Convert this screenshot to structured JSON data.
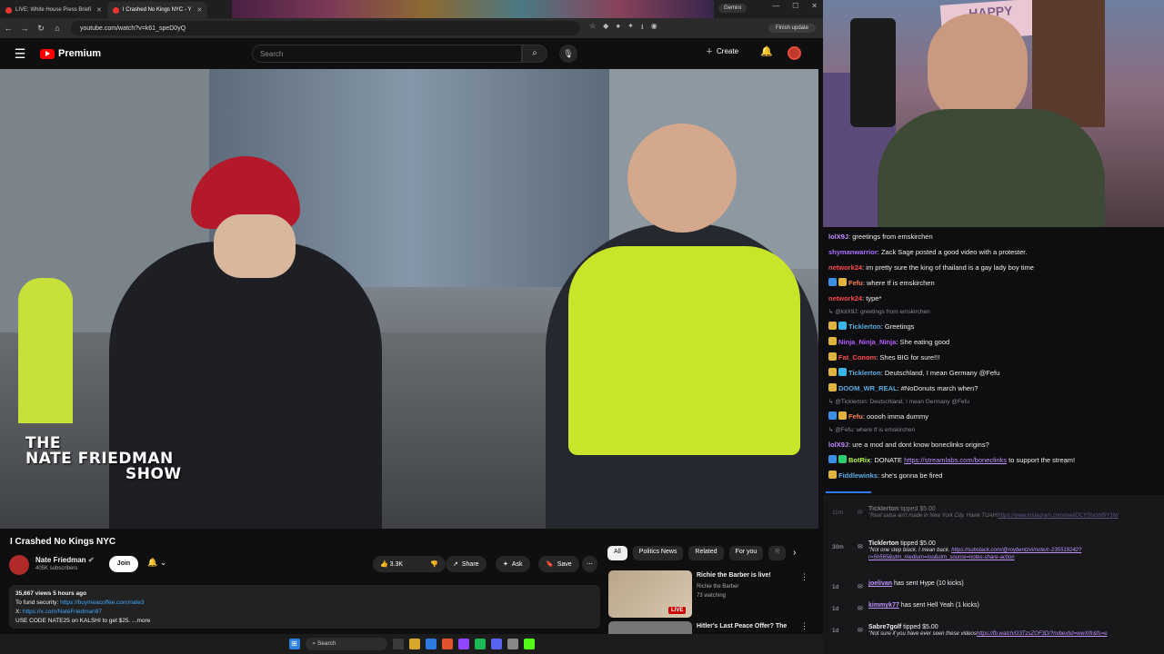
{
  "browser": {
    "tabs": [
      {
        "label": "LIVE: White House Press Briefi"
      },
      {
        "label": "I Crashed No Kings NYC - Y"
      }
    ],
    "gemini_label": "Gemini",
    "url": "youtube.com/watch?v=k61_speD0yQ",
    "finish_update": "Finish update"
  },
  "youtube": {
    "logo_text": "Premium",
    "search_placeholder": "Search",
    "create_label": "Create",
    "video_overlay": {
      "line1": "THE",
      "line2": "NATE FRIEDMAN",
      "line3": "SHOW"
    },
    "title": "I Crashed No Kings NYC",
    "channel": {
      "name": "Nate Friedman",
      "subscribers": "405K subscribers",
      "join": "Join"
    },
    "actions": {
      "likes": "3.3K",
      "share": "Share",
      "ask": "Ask",
      "save": "Save"
    },
    "description": {
      "meta": "35,667 views  5 hours ago",
      "line2_prefix": "To fund security: ",
      "line2_link": "https://buymeacoffee.com/nate3",
      "line3_prefix": "X: ",
      "line3_link": "https://x.com/NateFriedman97",
      "line4": "USE CODE NATE25 on KALSHI to get $25. ...more"
    },
    "chips": [
      "All",
      "Politics News",
      "Related",
      "For you",
      "R"
    ],
    "related": [
      {
        "title": "Richie the Barber is live!",
        "channel": "Richie the Barber",
        "watching": "73 watching",
        "badge": "LIVE"
      },
      {
        "title": "Hitler's Last Peace Offer? The"
      }
    ]
  },
  "taskbar": {
    "search": "Search"
  },
  "webcam": {
    "banner": "HAPPY"
  },
  "chat": [
    {
      "user": "lolX9J",
      "color": "#c28aff",
      "text": "greetings from emskirchen",
      "badges": []
    },
    {
      "user": "shymanwarrior",
      "color": "#a970ff",
      "text": "Zack Sage posted a good video with a protester.",
      "badges": []
    },
    {
      "user": "network24",
      "color": "#ff4a4a",
      "text": "im pretty sure the king of thailand is a gay lady boy time",
      "badges": []
    },
    {
      "user": "Fefu",
      "color": "#ff7f50",
      "text": "where tf is emskirchen",
      "badges": [
        "#3a8ee6",
        "#e0b341"
      ]
    },
    {
      "user": "network24",
      "color": "#ff4a4a",
      "text": "type*",
      "badges": []
    },
    {
      "reply": "@lolX9J: greetings from emskirchen"
    },
    {
      "user": "Ticklerton",
      "color": "#5dade2",
      "text": "Greetings",
      "badges": [
        "#e0b341",
        "#3ab5e6"
      ]
    },
    {
      "user": "Ninja_Ninja_Ninja",
      "color": "#b65cff",
      "text": "She eating good",
      "badges": [
        "#e0b341"
      ]
    },
    {
      "user": "Fat_Conom",
      "color": "#ff4a4a",
      "text": "Shes BIG for sure!!!",
      "badges": [
        "#e0b341"
      ]
    },
    {
      "user": "Ticklerton",
      "color": "#5dade2",
      "text": "Deutschland, I mean Germany @Fefu",
      "badges": [
        "#e0b341",
        "#3ab5e6"
      ]
    },
    {
      "user": "DOOM_WR_REAL",
      "color": "#5dade2",
      "text": "#NoDonuts march when?",
      "badges": [
        "#e0b341"
      ]
    },
    {
      "reply": "@Ticklerton: Deutschland, I mean Germany @Fefu"
    },
    {
      "user": "Fefu",
      "color": "#ff7f50",
      "text": "ooooh imma dummy",
      "badges": [
        "#3a8ee6",
        "#e0b341"
      ]
    },
    {
      "reply": "@Fefu: where tf is emskirchen"
    },
    {
      "user": "lolX9J",
      "color": "#c28aff",
      "text": "ure a mod and dont know boneclinks origins?",
      "badges": []
    },
    {
      "user": "BotRix",
      "color": "#b3f542",
      "text": "DONATE ",
      "link": "https://streamlabs.com/boneclinks",
      "after": " to support the stream!",
      "badges": [
        "#3a8ee6",
        "#2ecc71"
      ]
    },
    {
      "user": "Fiddlewinks",
      "color": "#5dade2",
      "text": "she's gonna be fired",
      "badges": [
        "#e0b341"
      ]
    }
  ],
  "events": [
    {
      "time": "11m",
      "name": "Ticklerton",
      "action": " tipped $5.00",
      "sub": "\"Real salsa ain't made in New York City. Hawk TUAH!",
      "sub2": "https://www.instagram.com/reel/DCY5NcWf9Y1N/",
      "dim": true
    },
    {
      "time": "30m",
      "name": "Ticklerton",
      "action": " tipped $5.00",
      "sub": "\"Not one step black. I mean back. ",
      "sub2": "https://substack.com/@roybentzvi/note/c-235519242?r=5h565&utm_medium=ios&utm_source=notes-share-action",
      "dim": false
    },
    {
      "time": "1d",
      "name": "joelivan",
      "action": " has sent Hype (10 kicks)",
      "dim": false
    },
    {
      "time": "1d",
      "name": "kimmyk77",
      "action": " has sent Hell Yeah (1 kicks)",
      "dim": false
    },
    {
      "time": "1d",
      "name": "Sabre7golf",
      "action": " tipped $5.00",
      "sub": "\"Not sure if you have ever seen these videos",
      "sub2": "https://fb.watch/G3TzsZOF3D/?mibextid=wwXIfr&fs=e",
      "dim": false
    }
  ]
}
